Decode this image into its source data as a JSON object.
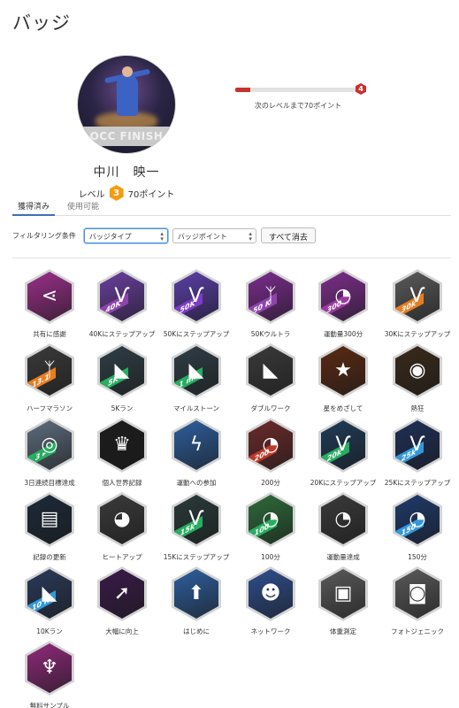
{
  "page": {
    "title": "バッジ"
  },
  "profile": {
    "name": "中川　映一",
    "level_label": "レベル",
    "level": "3",
    "points": "70ポイント",
    "photo_banner": "OCC FINISH"
  },
  "progress": {
    "fraction": 0.12,
    "next_level": "4",
    "caption": "次のレベルまで70ポイント"
  },
  "tabs": [
    {
      "label": "獲得済み",
      "active": true
    },
    {
      "label": "使用可能",
      "active": false
    }
  ],
  "filters": {
    "label": "フィルタリング条件",
    "badge_type": "バッジタイプ",
    "badge_points": "バッジポイント",
    "clear_button": "すべて消去"
  },
  "badges": [
    {
      "label": "共有に感謝",
      "bg": "#9b2f8a",
      "ribbon": "",
      "ribbon_color": "",
      "icon": "share-icon",
      "glyph": "⋖"
    },
    {
      "label": "40Kにステップアップ",
      "bg": "#6a3fa0",
      "ribbon": "40K",
      "ribbon_color": "#8e44ad",
      "icon": "wings-icon",
      "glyph": "Ѵ"
    },
    {
      "label": "50Kにステップアップ",
      "bg": "#5b3fa8",
      "ribbon": "50K",
      "ribbon_color": "#7d3cc8",
      "icon": "wings-icon",
      "glyph": "Ѵ"
    },
    {
      "label": "50Kウルトラ",
      "bg": "#7b2c8e",
      "ribbon": "50 K",
      "ribbon_color": "#8e44ad",
      "icon": "winged-shoe-icon",
      "glyph": "ᛉ"
    },
    {
      "label": "運動量300分",
      "bg": "#7d2e8c",
      "ribbon": "300",
      "ribbon_color": "#9b3b9e",
      "icon": "stopwatch-icon",
      "glyph": "◔"
    },
    {
      "label": "30Kにステップアップ",
      "bg": "#5a5a5a",
      "ribbon": "30k",
      "ribbon_color": "#e67e22",
      "icon": "wings-icon",
      "glyph": "Ѵ"
    },
    {
      "label": "ハーフマラソン",
      "bg": "#3a3a3a",
      "ribbon": "13.1",
      "ribbon_color": "#e67e22",
      "icon": "winged-shoe-icon",
      "glyph": "ᛉ"
    },
    {
      "label": "5Kラン",
      "bg": "#2f3e46",
      "ribbon": "5K",
      "ribbon_color": "#27ae60",
      "icon": "running-shoe-icon",
      "glyph": "◣"
    },
    {
      "label": "マイルストーン",
      "bg": "#2f3e46",
      "ribbon": "1 mi",
      "ribbon_color": "#27ae60",
      "icon": "running-shoe-icon",
      "glyph": "◣"
    },
    {
      "label": "ダブルワーク",
      "bg": "#3a3a3a",
      "ribbon": "",
      "ribbon_color": "",
      "icon": "double-shoe-icon",
      "glyph": "◣"
    },
    {
      "label": "星をめざして",
      "bg": "#5a2a12",
      "ribbon": "",
      "ribbon_color": "",
      "icon": "stars-icon",
      "glyph": "★"
    },
    {
      "label": "熱狂",
      "bg": "#3a2a1a",
      "ribbon": "",
      "ribbon_color": "",
      "icon": "fire-icon",
      "glyph": "◉"
    },
    {
      "label": "3日連続目標達成",
      "bg": "#5d6d7e",
      "ribbon": "3 ▸",
      "ribbon_color": "#27ae60",
      "icon": "target-icon",
      "glyph": "◎"
    },
    {
      "label": "個人世界記録",
      "bg": "#1c1c1c",
      "ribbon": "",
      "ribbon_color": "",
      "icon": "crown-icon",
      "glyph": "♛"
    },
    {
      "label": "運動への参加",
      "bg": "#2e5f9e",
      "ribbon": "",
      "ribbon_color": "",
      "icon": "lightning-icon",
      "glyph": "ϟ"
    },
    {
      "label": "200分",
      "bg": "#6b2a2a",
      "ribbon": "200",
      "ribbon_color": "#c0392b",
      "icon": "stopwatch-icon",
      "glyph": "◔"
    },
    {
      "label": "20Kにステップアップ",
      "bg": "#1f3b57",
      "ribbon": "20k",
      "ribbon_color": "#27ae60",
      "icon": "wings-icon",
      "glyph": "Ѵ"
    },
    {
      "label": "25Kにステップアップ",
      "bg": "#1f2f57",
      "ribbon": "25k",
      "ribbon_color": "#3498db",
      "icon": "wings-icon",
      "glyph": "Ѵ"
    },
    {
      "label": "記録の更新",
      "bg": "#1c2a3a",
      "ribbon": "",
      "ribbon_color": "",
      "icon": "best-yesterday-icon",
      "glyph": "▤"
    },
    {
      "label": "ヒートアップ",
      "bg": "#3a3a3a",
      "ribbon": "",
      "ribbon_color": "",
      "icon": "rocket-icon",
      "glyph": "◕"
    },
    {
      "label": "15Kにステップアップ",
      "bg": "#2a3a3a",
      "ribbon": "15k",
      "ribbon_color": "#27ae60",
      "icon": "wings-icon",
      "glyph": "Ѵ"
    },
    {
      "label": "100分",
      "bg": "#2e6b3a",
      "ribbon": "100",
      "ribbon_color": "#27ae60",
      "icon": "stopwatch-icon",
      "glyph": "◔"
    },
    {
      "label": "運動量達成",
      "bg": "#3a3a3a",
      "ribbon": "",
      "ribbon_color": "",
      "icon": "stopwatch-icon",
      "glyph": "◔"
    },
    {
      "label": "150分",
      "bg": "#1f3a6b",
      "ribbon": "150",
      "ribbon_color": "#3498db",
      "icon": "stopwatch-icon",
      "glyph": "◔"
    },
    {
      "label": "10Kラン",
      "bg": "#2a3a5a",
      "ribbon": "10 K",
      "ribbon_color": "#3498db",
      "icon": "running-shoe-icon",
      "glyph": "◣"
    },
    {
      "label": "大幅に向上",
      "bg": "#3a1a4a",
      "ribbon": "",
      "ribbon_color": "",
      "icon": "arrow-up-icon",
      "glyph": "➚"
    },
    {
      "label": "はじめに",
      "bg": "#2e5f9e",
      "ribbon": "",
      "ribbon_color": "",
      "icon": "arrow-up-icon",
      "glyph": "⬆"
    },
    {
      "label": "ネットワーク",
      "bg": "#2e4f8e",
      "ribbon": "",
      "ribbon_color": "",
      "icon": "people-icon",
      "glyph": "☻"
    },
    {
      "label": "体重測定",
      "bg": "#5a5a5a",
      "ribbon": "",
      "ribbon_color": "",
      "icon": "scale-icon",
      "glyph": "▣"
    },
    {
      "label": "フォトジェニック",
      "bg": "#5a5a5a",
      "ribbon": "",
      "ribbon_color": "",
      "icon": "camera-icon",
      "glyph": "◙"
    },
    {
      "label": "無料サンプル",
      "bg": "#8e2a7a",
      "ribbon": "",
      "ribbon_color": "",
      "icon": "trophy-icon",
      "glyph": "♆"
    }
  ]
}
